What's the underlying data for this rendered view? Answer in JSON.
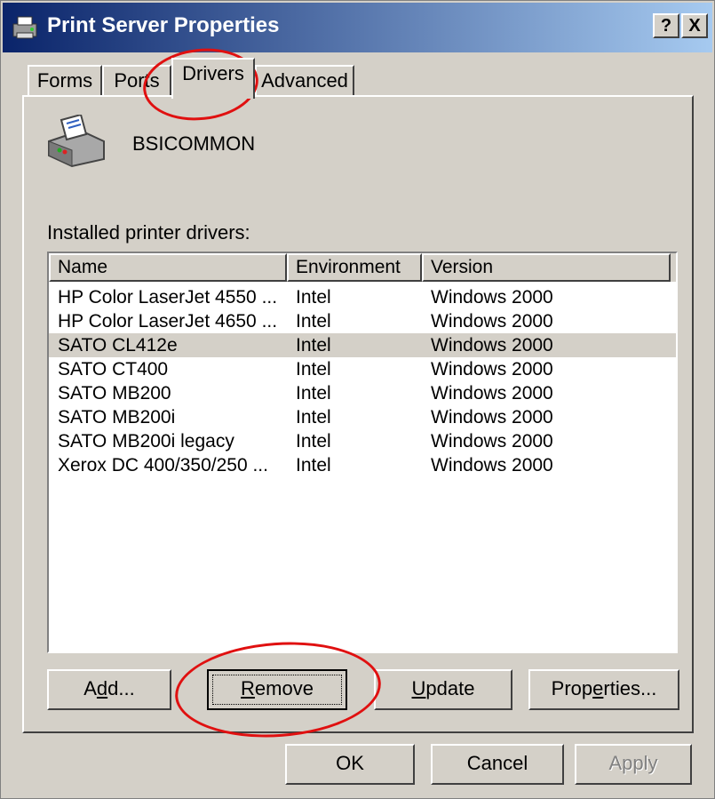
{
  "window": {
    "title": "Print Server Properties"
  },
  "titlebar_buttons": {
    "help": "?",
    "close": "X"
  },
  "tabs": [
    {
      "label": "Forms",
      "active": false
    },
    {
      "label": "Ports",
      "active": false
    },
    {
      "label": "Drivers",
      "active": true
    },
    {
      "label": "Advanced",
      "active": false
    }
  ],
  "server_name": "BSICOMMON",
  "list_label": "Installed printer drivers:",
  "columns": [
    "Name",
    "Environment",
    "Version"
  ],
  "drivers": [
    {
      "name": "HP Color LaserJet 4550 ...",
      "environment": "Intel",
      "version": "Windows 2000",
      "selected": false
    },
    {
      "name": "HP Color LaserJet 4650 ...",
      "environment": "Intel",
      "version": "Windows 2000",
      "selected": false
    },
    {
      "name": "SATO CL412e",
      "environment": "Intel",
      "version": "Windows 2000",
      "selected": true
    },
    {
      "name": "SATO CT400",
      "environment": "Intel",
      "version": "Windows 2000",
      "selected": false
    },
    {
      "name": "SATO MB200",
      "environment": "Intel",
      "version": "Windows 2000",
      "selected": false
    },
    {
      "name": "SATO MB200i",
      "environment": "Intel",
      "version": "Windows 2000",
      "selected": false
    },
    {
      "name": "SATO MB200i legacy",
      "environment": "Intel",
      "version": "Windows 2000",
      "selected": false
    },
    {
      "name": "Xerox DC 400/350/250 ...",
      "environment": "Intel",
      "version": "Windows 2000",
      "selected": false
    }
  ],
  "panel_buttons": {
    "add": {
      "pre": "A",
      "key": "d",
      "post": "d..."
    },
    "remove": {
      "pre": "",
      "key": "R",
      "post": "emove"
    },
    "update": {
      "pre": "",
      "key": "U",
      "post": "pdate"
    },
    "properties": {
      "pre": "Prop",
      "key": "e",
      "post": "rties..."
    }
  },
  "dialog_buttons": {
    "ok": "OK",
    "cancel": "Cancel",
    "apply": "Apply"
  },
  "colors": {
    "title_start": "#0a246a",
    "title_end": "#a6caf0",
    "annotation": "#e01010",
    "face": "#d4d0c8"
  }
}
